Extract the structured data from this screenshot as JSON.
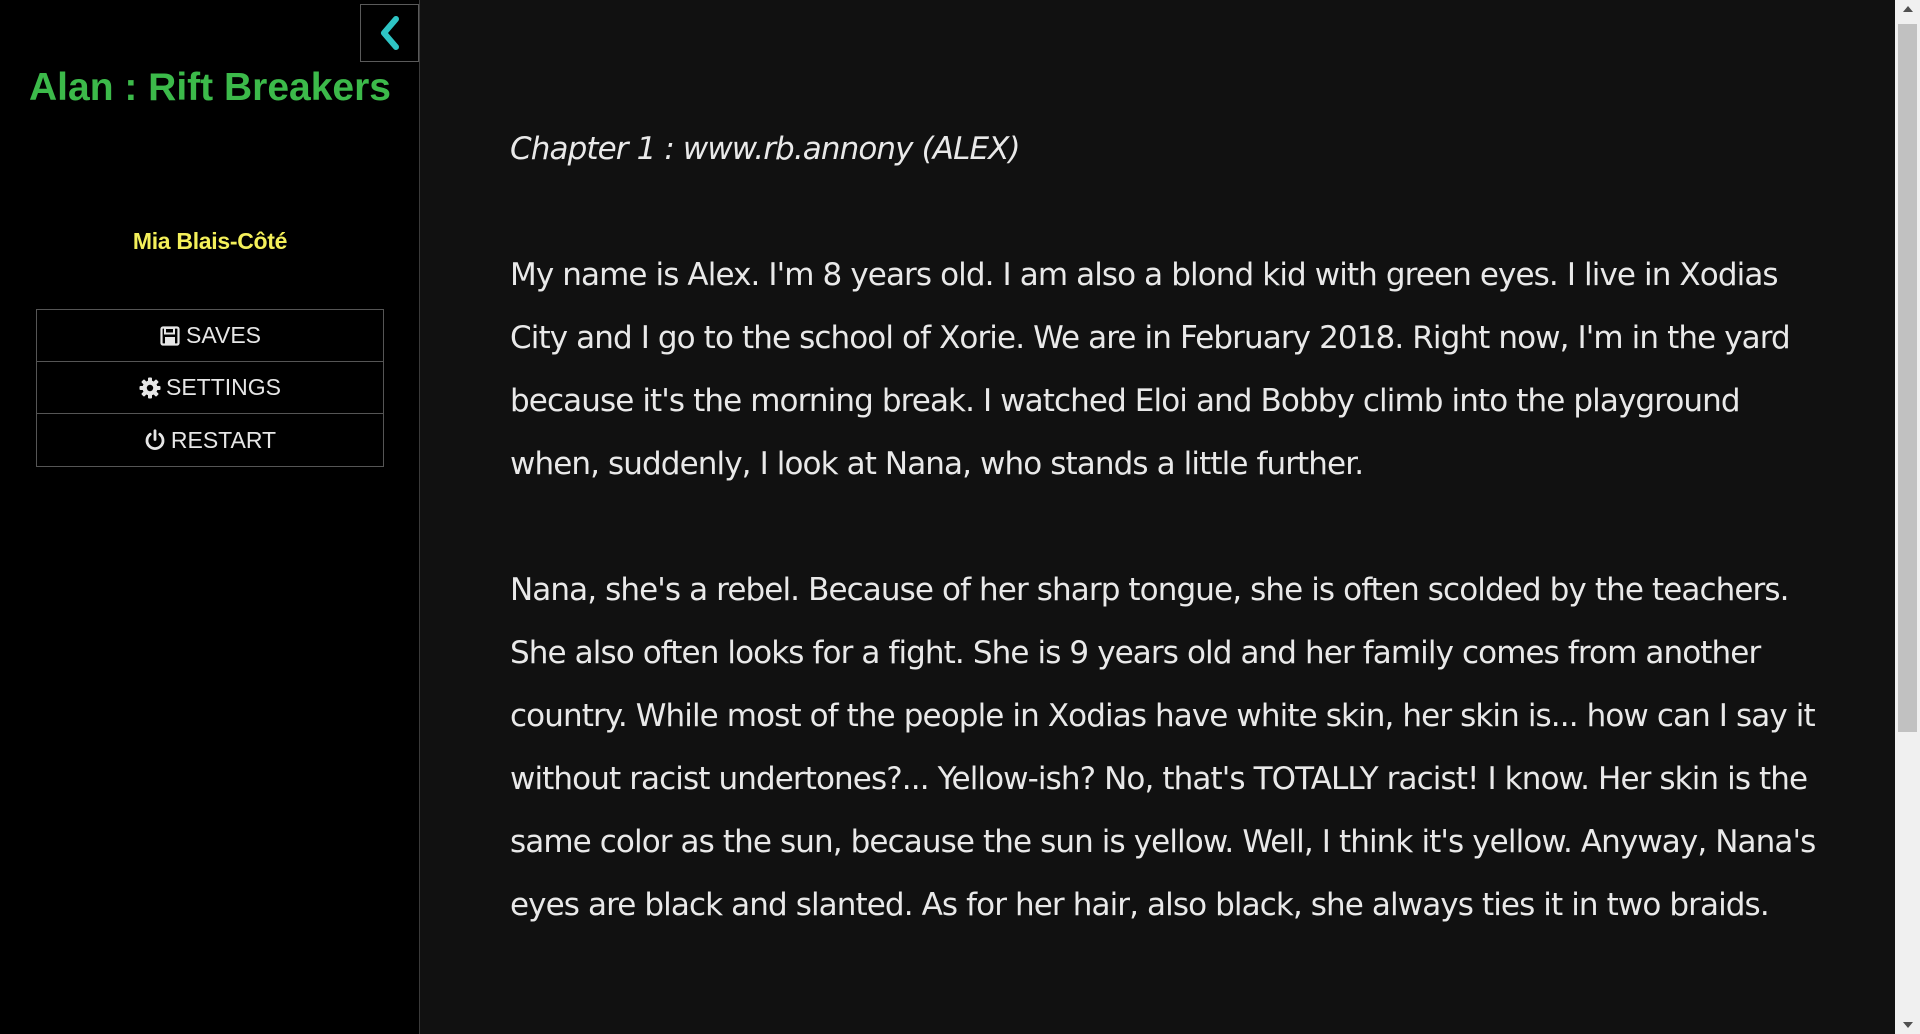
{
  "sidebar": {
    "toggle_icon": "chevron-left-icon",
    "title": "Alan : Rift Breakers",
    "author": "Mia Blais-Côté",
    "menu": [
      {
        "label": "SAVES",
        "icon": "floppy-disk-icon"
      },
      {
        "label": "SETTINGS",
        "icon": "gear-icon"
      },
      {
        "label": "RESTART",
        "icon": "power-icon"
      }
    ]
  },
  "passage": {
    "chapter_heading": "Chapter 1 : www.rb.annony (ALEX)",
    "paragraphs": [
      "My name is Alex. I'm 8 years old. I am also a blond kid with green eyes. I live in Xodias City and I go to the school of Xorie. We are in February 2018. Right now, I'm in the yard because it's the morning break. I watched Eloi and Bobby climb into the playground when, suddenly, I look at Nana, who stands a little further.",
      "Nana, she's a rebel. Because of her sharp tongue, she is often scolded by the teachers. She also often looks for a fight. She is 9 years old and her family comes from another country. While most of the people in Xodias have white skin, her skin is... how can I say it without racist undertones?... Yellow-ish? No, that's TOTALLY racist! I know. Her skin is the same color as the sun, because the sun is yellow. Well, I think it's yellow. Anyway, Nana's eyes are black and slanted. As for her hair, also black, she always ties it in two braids."
    ]
  },
  "colors": {
    "title": "#3cba4a",
    "author": "#f4f05a",
    "toggle_icon": "#2ec4c4",
    "text": "#e9e9e9",
    "sidebar_bg": "#000000",
    "main_bg": "#111111"
  }
}
